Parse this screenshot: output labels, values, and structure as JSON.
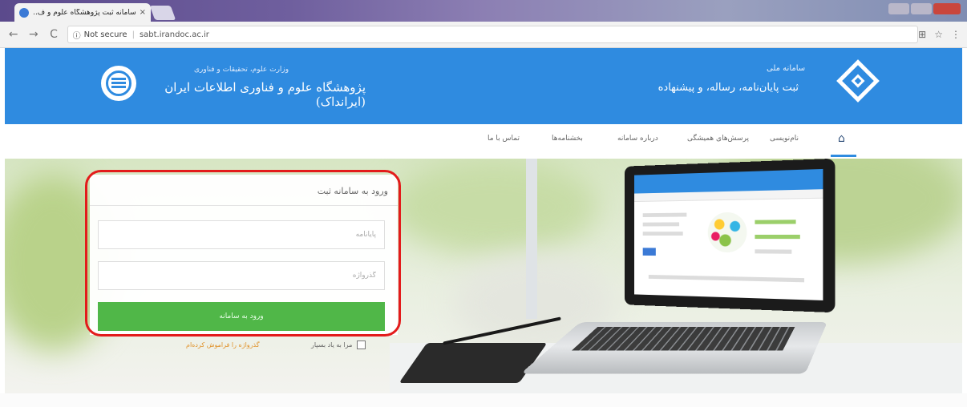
{
  "browser": {
    "tab_title": "سامانه ثبت پژوهشگاه علوم و ف...",
    "tab_close": "×",
    "nav_back": "←",
    "nav_forward": "→",
    "nav_reload": "C",
    "security_icon": "ⓘ",
    "security_label": "Not secure",
    "url_separator": "|",
    "url": "sabt.irandoc.ac.ir",
    "translate_icon": "⊞",
    "star_icon": "☆",
    "menu_icon": "⋮"
  },
  "header": {
    "org_small": "وزارت علوم، تحقیقات و فناوری",
    "org_name": "پژوهشگاه علوم و فناوری اطلاعات ایران (ایرانداک)",
    "system_small": "سامانه ملی",
    "system_name": "ثبت پایان‌نامه، رساله، و پیشنهاده",
    "brand_color": "#2f8be0"
  },
  "nav": {
    "home_icon": "home-icon",
    "items": [
      "نام‌نویسی",
      "پرسش‌های همیشگی",
      "درباره سامانه",
      "بخشنامه‌ها",
      "تماس با ما"
    ]
  },
  "login": {
    "title": "ورود به سامانه ثبت",
    "username_placeholder": "پایانامه",
    "password_placeholder": "گذرواژه",
    "submit_label": "ورود به سامانه",
    "remember_label": "مرا به یاد بسپار",
    "forgot_label": "گذرواژه را فراموش کرده‌ام",
    "submit_color": "#50b748",
    "highlight_color": "#e31b1b"
  }
}
